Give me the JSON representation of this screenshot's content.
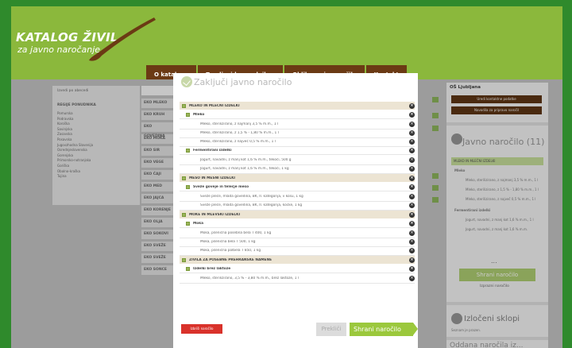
{
  "logo": {
    "title": "KATALOG ŽIVIL",
    "subtitle": "za javno naročanje"
  },
  "nav": [
    "O katalogu",
    "Zemljevid ponudnikov",
    "Oblikovanje naročila",
    "Kontakt"
  ],
  "left_panel": {
    "checkbox_label": "Izvedi po abecedi",
    "title": "REGIJE PONUDNIKA",
    "regions": [
      "Pomurska",
      "Podravska",
      "Koroška",
      "Savinjska",
      "Zasavska",
      "Posavska",
      "Jugovzhodna Slovenija",
      "Osrednjeslovenska",
      "Gorenjska",
      "Primorsko-notranjska",
      "Goriška",
      "Obalno-kraška",
      "Tujina"
    ]
  },
  "middle_list": [
    "EKO MLEKO",
    "EKO KRUH",
    "EKO GOVEDINA",
    "EKO MOKA",
    "EKO SIR",
    "EKO VEGE",
    "EKO ČAJI",
    "EKO MED",
    "EKO JAJCA",
    "EKO KORENJE",
    "EKO OLJA",
    "EKO SOKOVI",
    "EKO SVEŽE",
    "EKO SVEŽE",
    "EKO SONCE"
  ],
  "right_panel": {
    "school": "OŠ Ljubljana",
    "btn1": "Uredi kontaktne podatke",
    "btn2": "Navodila za pripravo naročil",
    "order_title": "Javno naročilo (11)",
    "cat": "MLEKO IN MLEČNI IZDELKI",
    "sub": "Mleko",
    "rows": [
      "Mleko, sterilizirano, z najmanj 3,5 % m.m., 1 l",
      "Mleko, sterilizirano, z 1,5 % - 1,80 % m.m., 1 l",
      "Mleko, sterilizirano, z največ 0,5 % m.m., 1 l"
    ],
    "sub2": "Fermentirani izdelki",
    "rows2": [
      "Jogurt, navadni, z manj kot 1,6 % m.m., 1 l",
      "Jogurt, navadni, z manj kot 1,6 % m.m."
    ],
    "dots": "...",
    "save": "Shrani naročilo",
    "remove": "Izprazni naročilo",
    "lots_title": "Izločeni sklopi",
    "lots_sub": "Seznam je prazen.",
    "sent_title": "Oddana naročila iz..."
  },
  "modal": {
    "title": "Zaključi javno naročilo",
    "delete_label": "Izbriši naročilo",
    "cancel_label": "Prekliči",
    "save_label": "Shrani naročilo"
  },
  "order": [
    {
      "type": "cat",
      "text": "MLEKO IN MLEČNI IZDELKI"
    },
    {
      "type": "sub",
      "text": "Mleko"
    },
    {
      "type": "item",
      "text": "Mleko, sterilizirano, z najmanj 3,5 % m.m., 1 l"
    },
    {
      "type": "item",
      "text": "Mleko, sterilizirano, z 1,5 % - 1,80 % m.m., 1 l"
    },
    {
      "type": "item",
      "text": "Mleko, sterilizirano, z največ 0,5 % m.m., 1 l"
    },
    {
      "type": "sub",
      "text": "Fermentirani izdelki"
    },
    {
      "type": "item",
      "text": "Jogurt, navadni, z manj kot 1,6 % m.m., tekoči, 500 g"
    },
    {
      "type": "item",
      "text": "Jogurt, navadni, z manj kot 1,6 % m.m., tekoči, 1 kg"
    },
    {
      "type": "cat",
      "text": "MESO IN MESNI IZDELKI"
    },
    {
      "type": "sub",
      "text": "Sveže goveje in telečje meso"
    },
    {
      "type": "item",
      "text": "Sveže pleče, mlada govedina, BK, II. kategorija, v kosu, 1 kg"
    },
    {
      "type": "item",
      "text": "Sveže pleče, mlada govedina, BK, II. kategorija, kocke, 1 kg"
    },
    {
      "type": "cat",
      "text": "MOKE IN MLEVSKI IZDELKI"
    },
    {
      "type": "sub",
      "text": "Moka"
    },
    {
      "type": "item",
      "text": "Moka, pšenična posebna bela T 400, 1 kg"
    },
    {
      "type": "item",
      "text": "Moka, pšenična bela T 500, 1 kg"
    },
    {
      "type": "item",
      "text": "Moka, pšenična polbela T 850, 1 kg"
    },
    {
      "type": "cat",
      "text": "ŽIVILA ZA POSEBNE PREHRANSKE NAMENE"
    },
    {
      "type": "sub",
      "text": "Izdelki brez laktoze"
    },
    {
      "type": "item",
      "text": "Mleko, sterilizirano, 3,5 % - 3,80 % m.m., brez laktoze, 1 l"
    }
  ]
}
